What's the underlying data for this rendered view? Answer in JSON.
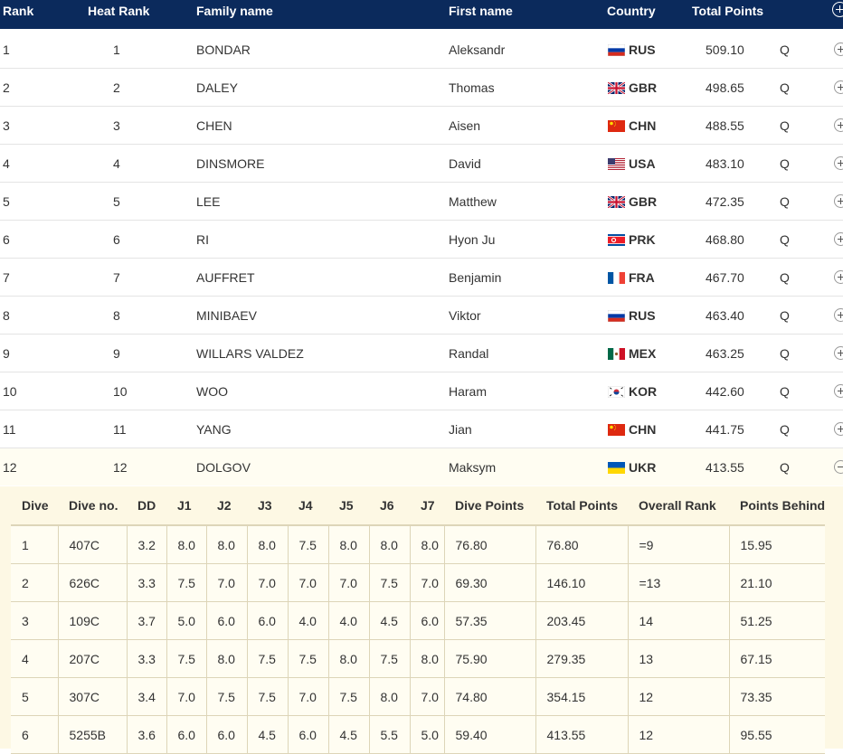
{
  "header": {
    "rank": "Rank",
    "heat_rank": "Heat Rank",
    "family_name": "Family name",
    "first_name": "First name",
    "country": "Country",
    "total_points": "Total Points"
  },
  "results": [
    {
      "rank": "1",
      "heat_rank": "1",
      "family": "BONDAR",
      "first": "Aleksandr",
      "flag": "rus-flag-icon",
      "country": "RUS",
      "points": "509.10",
      "q": "Q"
    },
    {
      "rank": "2",
      "heat_rank": "2",
      "family": "DALEY",
      "first": "Thomas",
      "flag": "gbr-flag-icon",
      "country": "GBR",
      "points": "498.65",
      "q": "Q"
    },
    {
      "rank": "3",
      "heat_rank": "3",
      "family": "CHEN",
      "first": "Aisen",
      "flag": "chn-flag-icon",
      "country": "CHN",
      "points": "488.55",
      "q": "Q"
    },
    {
      "rank": "4",
      "heat_rank": "4",
      "family": "DINSMORE",
      "first": "David",
      "flag": "usa-flag-icon",
      "country": "USA",
      "points": "483.10",
      "q": "Q"
    },
    {
      "rank": "5",
      "heat_rank": "5",
      "family": "LEE",
      "first": "Matthew",
      "flag": "gbr-flag-icon",
      "country": "GBR",
      "points": "472.35",
      "q": "Q"
    },
    {
      "rank": "6",
      "heat_rank": "6",
      "family": "RI",
      "first": "Hyon Ju",
      "flag": "prk-flag-icon",
      "country": "PRK",
      "points": "468.80",
      "q": "Q"
    },
    {
      "rank": "7",
      "heat_rank": "7",
      "family": "AUFFRET",
      "first": "Benjamin",
      "flag": "fra-flag-icon",
      "country": "FRA",
      "points": "467.70",
      "q": "Q"
    },
    {
      "rank": "8",
      "heat_rank": "8",
      "family": "MINIBAEV",
      "first": "Viktor",
      "flag": "rus-flag-icon",
      "country": "RUS",
      "points": "463.40",
      "q": "Q"
    },
    {
      "rank": "9",
      "heat_rank": "9",
      "family": "WILLARS VALDEZ",
      "first": "Randal",
      "flag": "mex-flag-icon",
      "country": "MEX",
      "points": "463.25",
      "q": "Q"
    },
    {
      "rank": "10",
      "heat_rank": "10",
      "family": "WOO",
      "first": "Haram",
      "flag": "kor-flag-icon",
      "country": "KOR",
      "points": "442.60",
      "q": "Q"
    },
    {
      "rank": "11",
      "heat_rank": "11",
      "family": "YANG",
      "first": "Jian",
      "flag": "chn-flag-icon",
      "country": "CHN",
      "points": "441.75",
      "q": "Q"
    },
    {
      "rank": "12",
      "heat_rank": "12",
      "family": "DOLGOV",
      "first": "Maksym",
      "flag": "ukr-flag-icon",
      "country": "UKR",
      "points": "413.55",
      "q": "Q"
    }
  ],
  "dive_detail": {
    "headers": [
      "Dive",
      "Dive no.",
      "DD",
      "J1",
      "J2",
      "J3",
      "J4",
      "J5",
      "J6",
      "J7",
      "Dive Points",
      "Total Points",
      "Overall Rank",
      "Points Behind"
    ],
    "rows": [
      [
        "1",
        "407C",
        "3.2",
        "8.0",
        "8.0",
        "8.0",
        "7.5",
        "8.0",
        "8.0",
        "8.0",
        "76.80",
        "76.80",
        "=9",
        "15.95"
      ],
      [
        "2",
        "626C",
        "3.3",
        "7.5",
        "7.0",
        "7.0",
        "7.0",
        "7.0",
        "7.5",
        "7.0",
        "69.30",
        "146.10",
        "=13",
        "21.10"
      ],
      [
        "3",
        "109C",
        "3.7",
        "5.0",
        "6.0",
        "6.0",
        "4.0",
        "4.0",
        "4.5",
        "6.0",
        "57.35",
        "203.45",
        "14",
        "51.25"
      ],
      [
        "4",
        "207C",
        "3.3",
        "7.5",
        "8.0",
        "7.5",
        "7.5",
        "8.0",
        "7.5",
        "8.0",
        "75.90",
        "279.35",
        "13",
        "67.15"
      ],
      [
        "5",
        "307C",
        "3.4",
        "7.0",
        "7.5",
        "7.5",
        "7.0",
        "7.5",
        "8.0",
        "7.0",
        "74.80",
        "354.15",
        "12",
        "73.35"
      ],
      [
        "6",
        "5255B",
        "3.6",
        "6.0",
        "6.0",
        "4.5",
        "6.0",
        "4.5",
        "5.5",
        "5.0",
        "59.40",
        "413.55",
        "12",
        "95.55"
      ]
    ]
  },
  "colors": {
    "header_bg": "#0b2a5c",
    "expanded_bg": "#fdf8e4"
  }
}
